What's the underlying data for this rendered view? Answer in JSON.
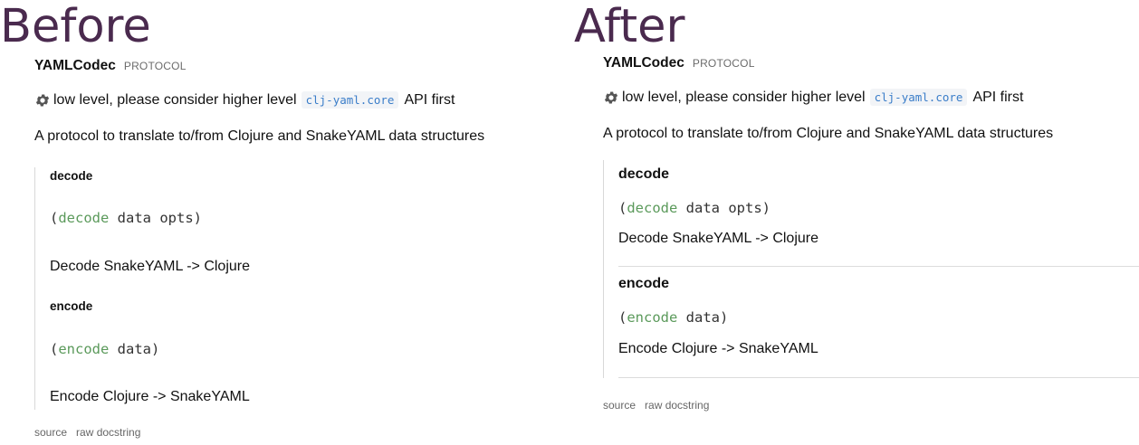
{
  "before": {
    "heading": "Before",
    "protocol_name": "YAMLCodec",
    "protocol_kind": "PROTOCOL",
    "note": {
      "icon": "gear-icon",
      "text_before": "low level, please consider higher level",
      "code": "clj-yaml.core",
      "text_after": "API first"
    },
    "description": "A protocol to translate to/from Clojure and SnakeYAML data structures",
    "methods": [
      {
        "name": "decode",
        "sig_open": "(",
        "sig_fn": "decode",
        "sig_args": " data opts)",
        "doc": "Decode SnakeYAML -> Clojure"
      },
      {
        "name": "encode",
        "sig_open": "(",
        "sig_fn": "encode",
        "sig_args": " data)",
        "doc": "Encode Clojure -> SnakeYAML"
      }
    ],
    "links": {
      "source": "source",
      "raw_docstring": "raw docstring"
    }
  },
  "after": {
    "heading": "After",
    "protocol_name": "YAMLCodec",
    "protocol_kind": "PROTOCOL",
    "note": {
      "icon": "gear-icon",
      "text_before": "low level, please consider higher level",
      "code": "clj-yaml.core",
      "text_after": "API first"
    },
    "description": "A protocol to translate to/from Clojure and SnakeYAML data structures",
    "methods": [
      {
        "name": "decode",
        "sig_open": "(",
        "sig_fn": "decode",
        "sig_args": " data opts)",
        "doc": "Decode SnakeYAML -> Clojure"
      },
      {
        "name": "encode",
        "sig_open": "(",
        "sig_fn": "encode",
        "sig_args": " data)",
        "doc": "Encode Clojure -> SnakeYAML"
      }
    ],
    "links": {
      "source": "source",
      "raw_docstring": "raw docstring"
    }
  },
  "colors": {
    "heading": "#4a2a4e",
    "fn_name": "#5b9a5b",
    "inline_code": "#3a7dc9"
  }
}
